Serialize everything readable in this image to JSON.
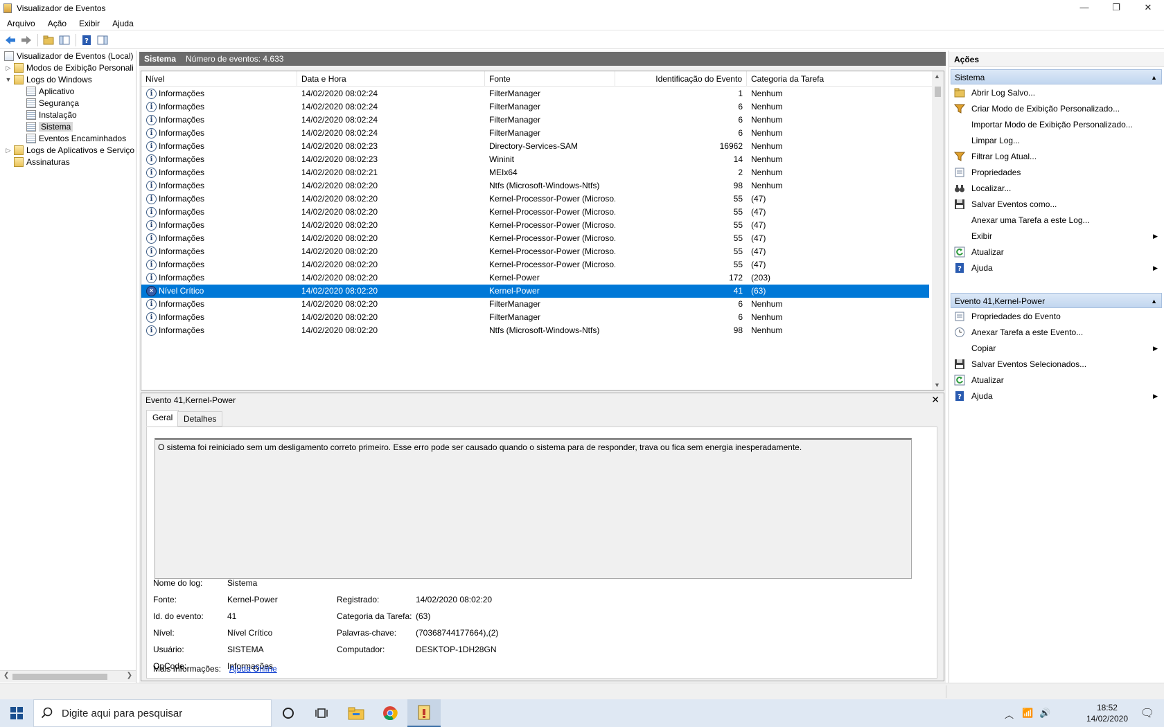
{
  "window": {
    "title": "Visualizador de Eventos",
    "min_glyph": "—",
    "max_glyph": "❐",
    "close_glyph": "✕"
  },
  "menu": [
    "Arquivo",
    "Ação",
    "Exibir",
    "Ajuda"
  ],
  "toolbar_icons": [
    "back-icon",
    "forward-icon",
    "open-folder-icon",
    "console-tree-icon",
    "help-icon",
    "action-pane-icon"
  ],
  "tree": {
    "root": "Visualizador de Eventos (Local)",
    "custom_views": "Modos de Exibição Personali",
    "windows_logs": "Logs do Windows",
    "app": "Aplicativo",
    "security": "Segurança",
    "setup": "Instalação",
    "system": "Sistema",
    "forwarded": "Eventos Encaminhados",
    "apps_services": "Logs de Aplicativos e Serviço",
    "subscriptions": "Assinaturas"
  },
  "list": {
    "name": "Sistema",
    "count": "Número de eventos: 4.633",
    "columns": [
      "Nível",
      "Data e Hora",
      "Fonte",
      "Identificação do Evento",
      "Categoria da Tarefa"
    ],
    "rows": [
      {
        "level": "Informações",
        "datetime": "14/02/2020 08:02:24",
        "source": "FilterManager",
        "id": "1",
        "category": "Nenhum"
      },
      {
        "level": "Informações",
        "datetime": "14/02/2020 08:02:24",
        "source": "FilterManager",
        "id": "6",
        "category": "Nenhum"
      },
      {
        "level": "Informações",
        "datetime": "14/02/2020 08:02:24",
        "source": "FilterManager",
        "id": "6",
        "category": "Nenhum"
      },
      {
        "level": "Informações",
        "datetime": "14/02/2020 08:02:24",
        "source": "FilterManager",
        "id": "6",
        "category": "Nenhum"
      },
      {
        "level": "Informações",
        "datetime": "14/02/2020 08:02:23",
        "source": "Directory-Services-SAM",
        "id": "16962",
        "category": "Nenhum"
      },
      {
        "level": "Informações",
        "datetime": "14/02/2020 08:02:23",
        "source": "Wininit",
        "id": "14",
        "category": "Nenhum"
      },
      {
        "level": "Informações",
        "datetime": "14/02/2020 08:02:21",
        "source": "MEIx64",
        "id": "2",
        "category": "Nenhum"
      },
      {
        "level": "Informações",
        "datetime": "14/02/2020 08:02:20",
        "source": "Ntfs (Microsoft-Windows-Ntfs)",
        "id": "98",
        "category": "Nenhum"
      },
      {
        "level": "Informações",
        "datetime": "14/02/2020 08:02:20",
        "source": "Kernel-Processor-Power (Microso...",
        "id": "55",
        "category": "(47)"
      },
      {
        "level": "Informações",
        "datetime": "14/02/2020 08:02:20",
        "source": "Kernel-Processor-Power (Microso...",
        "id": "55",
        "category": "(47)"
      },
      {
        "level": "Informações",
        "datetime": "14/02/2020 08:02:20",
        "source": "Kernel-Processor-Power (Microso...",
        "id": "55",
        "category": "(47)"
      },
      {
        "level": "Informações",
        "datetime": "14/02/2020 08:02:20",
        "source": "Kernel-Processor-Power (Microso...",
        "id": "55",
        "category": "(47)"
      },
      {
        "level": "Informações",
        "datetime": "14/02/2020 08:02:20",
        "source": "Kernel-Processor-Power (Microso...",
        "id": "55",
        "category": "(47)"
      },
      {
        "level": "Informações",
        "datetime": "14/02/2020 08:02:20",
        "source": "Kernel-Processor-Power (Microso...",
        "id": "55",
        "category": "(47)"
      },
      {
        "level": "Informações",
        "datetime": "14/02/2020 08:02:20",
        "source": "Kernel-Power",
        "id": "172",
        "category": "(203)"
      },
      {
        "level": "Nível Crítico",
        "datetime": "14/02/2020 08:02:20",
        "source": "Kernel-Power",
        "id": "41",
        "category": "(63)",
        "selected": true,
        "critical": true
      },
      {
        "level": "Informações",
        "datetime": "14/02/2020 08:02:20",
        "source": "FilterManager",
        "id": "6",
        "category": "Nenhum"
      },
      {
        "level": "Informações",
        "datetime": "14/02/2020 08:02:20",
        "source": "FilterManager",
        "id": "6",
        "category": "Nenhum"
      },
      {
        "level": "Informações",
        "datetime": "14/02/2020 08:02:20",
        "source": "Ntfs (Microsoft-Windows-Ntfs)",
        "id": "98",
        "category": "Nenhum"
      }
    ]
  },
  "detail": {
    "title": "Evento 41,Kernel-Power",
    "close": "✕",
    "tabs": [
      "Geral",
      "Detalhes"
    ],
    "description": "O sistema foi reiniciado sem um desligamento correto primeiro. Esse erro pode ser causado quando o sistema para de responder, trava ou fica sem energia inesperadamente.",
    "log_name_label": "Nome do log:",
    "log_name": "Sistema",
    "source_label": "Fonte:",
    "source": "Kernel-Power",
    "logged_label": "Registrado:",
    "logged": "14/02/2020 08:02:20",
    "event_id_label": "Id. do evento:",
    "event_id": "41",
    "task_cat_label": "Categoria da Tarefa:",
    "task_cat": "(63)",
    "level_label": "Nível:",
    "level": "Nível Crítico",
    "keywords_label": "Palavras-chave:",
    "keywords": "(70368744177664),(2)",
    "user_label": "Usuário:",
    "user": "SISTEMA",
    "computer_label": "Computador:",
    "computer": "DESKTOP-1DH28GN",
    "opcode_label": "OpCode:",
    "opcode": "Informações",
    "more_info_label": "Mais Informações:",
    "more_info_link": "Ajuda Online"
  },
  "actions": {
    "title": "Ações",
    "section1": "Sistema",
    "items1": [
      {
        "label": "Abrir Log Salvo...",
        "icon": "open-folder-icon"
      },
      {
        "label": "Criar Modo de Exibição Personalizado...",
        "icon": "filter-icon"
      },
      {
        "label": "Importar Modo de Exibição Personalizado...",
        "icon": ""
      },
      {
        "label": "Limpar Log...",
        "icon": ""
      },
      {
        "label": "Filtrar Log Atual...",
        "icon": "filter-icon"
      },
      {
        "label": "Propriedades",
        "icon": "properties-icon"
      },
      {
        "label": "Localizar...",
        "icon": "binoculars-icon"
      },
      {
        "label": "Salvar Eventos como...",
        "icon": "save-icon"
      },
      {
        "label": "Anexar uma Tarefa a este Log...",
        "icon": ""
      },
      {
        "label": "Exibir",
        "icon": "",
        "submenu": true
      },
      {
        "label": "Atualizar",
        "icon": "refresh-icon"
      },
      {
        "label": "Ajuda",
        "icon": "help-icon",
        "submenu": true
      }
    ],
    "section2": "Evento 41,Kernel-Power",
    "items2": [
      {
        "label": "Propriedades do Evento",
        "icon": "properties-icon"
      },
      {
        "label": "Anexar Tarefa a este Evento...",
        "icon": "task-icon"
      },
      {
        "label": "Copiar",
        "icon": "",
        "submenu": true
      },
      {
        "label": "Salvar Eventos Selecionados...",
        "icon": "save-icon"
      },
      {
        "label": "Atualizar",
        "icon": "refresh-icon"
      },
      {
        "label": "Ajuda",
        "icon": "help-icon",
        "submenu": true
      }
    ]
  },
  "taskbar": {
    "search_placeholder": "Digite aqui para pesquisar",
    "time": "18:52",
    "date": "14/02/2020"
  }
}
